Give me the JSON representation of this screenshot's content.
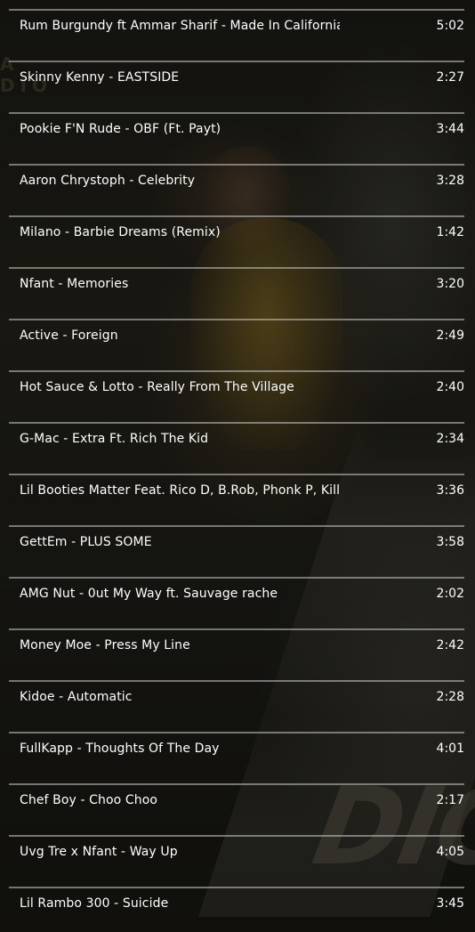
{
  "tracks": [
    {
      "title": "Rum Burgundy ft Ammar Sharif - Made In California",
      "duration": "5:02"
    },
    {
      "title": "Skinny Kenny - EASTSIDE",
      "duration": "2:27"
    },
    {
      "title": "Pookie F'N Rude - OBF (Ft. Payt)",
      "duration": "3:44"
    },
    {
      "title": "Aaron Chrystoph - Celebrity",
      "duration": "3:28"
    },
    {
      "title": "Milano - Barbie Dreams (Remix)",
      "duration": "1:42"
    },
    {
      "title": "Nfant - Memories",
      "duration": "3:20"
    },
    {
      "title": "Active - Foreign",
      "duration": "2:49"
    },
    {
      "title": "Hot Sauce & Lotto - Really From The Village",
      "duration": "2:40"
    },
    {
      "title": "G-Mac - Extra Ft. Rich The Kid",
      "duration": "2:34"
    },
    {
      "title": "Lil Booties Matter Feat. Rico D, B.Rob, Phonk P, Killa F",
      "duration": "3:36"
    },
    {
      "title": "GettEm - PLUS SOME",
      "duration": "3:58"
    },
    {
      "title": "AMG Nut - 0ut My Way ft. Sauvage rache",
      "duration": "2:02"
    },
    {
      "title": "Money Moe - Press My Line",
      "duration": "2:42"
    },
    {
      "title": "Kidoe - Automatic",
      "duration": "2:28"
    },
    {
      "title": "FullKapp - Thoughts Of The Day",
      "duration": "4:01"
    },
    {
      "title": "Chef Boy - Choo Choo",
      "duration": "2:17"
    },
    {
      "title": "Uvg Tre x Nfant - Way Up",
      "duration": "4:05"
    },
    {
      "title": "Lil Rambo 300 - Suicide",
      "duration": "3:45"
    }
  ],
  "background": {
    "corner_text": "A\nDIO",
    "watermark_text": "DIG"
  },
  "colors": {
    "text": "#ffffff",
    "divider": "#c8c8c8",
    "background": "#1c1b16"
  }
}
